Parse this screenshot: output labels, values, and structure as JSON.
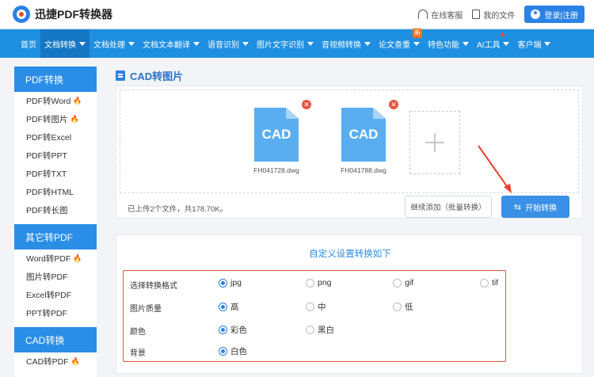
{
  "header": {
    "logo_text": "迅捷PDF转换器",
    "links": [
      {
        "icon": "headset-icon",
        "label": "在线客服"
      },
      {
        "icon": "file-icon",
        "label": "我的文件"
      }
    ],
    "login_label": "登录|注册"
  },
  "nav": {
    "items": [
      {
        "label": "首页"
      },
      {
        "label": "文档转换"
      },
      {
        "label": "文档处理"
      },
      {
        "label": "文档文本翻译"
      },
      {
        "label": "语音识别"
      },
      {
        "label": "图片文字识别"
      },
      {
        "label": "音视频转换"
      },
      {
        "label": "论文查重",
        "badge": "新"
      },
      {
        "label": "特色功能"
      },
      {
        "label": "AI工具"
      },
      {
        "label": "客户端"
      }
    ]
  },
  "sidebar": {
    "groups": [
      {
        "title": "PDF转换",
        "items": [
          "PDF转Word",
          "PDF转图片",
          "PDF转Excel",
          "PDF转PPT",
          "PDF转TXT",
          "PDF转HTML",
          "PDF转长图"
        ]
      },
      {
        "title": "其它转PDF",
        "items": [
          "Word转PDF",
          "图片转PDF",
          "Excel转PDF",
          "PPT转PDF"
        ]
      },
      {
        "title": "CAD转换",
        "items": [
          "CAD转PDF"
        ]
      }
    ]
  },
  "main": {
    "title": "CAD转图片",
    "files": [
      {
        "type_label": "CAD",
        "name": "FH041728.dwg"
      },
      {
        "type_label": "CAD",
        "name": "FH041788.dwg"
      }
    ],
    "remove_label": "✕",
    "upload_info": "已上传2个文件，共178.70K。",
    "continue_label": "继续添加（批量转换）",
    "start_label": "开始转换",
    "settings": {
      "title": "自定义设置转换如下",
      "rows": [
        {
          "label": "选择转换格式",
          "options": [
            "jpg",
            "png",
            "gif",
            "tif"
          ],
          "selected": "jpg"
        },
        {
          "label": "图片质量",
          "options": [
            "高",
            "中",
            "低"
          ],
          "selected": "高"
        },
        {
          "label": "颜色",
          "options": [
            "彩色",
            "黑白"
          ],
          "selected": "彩色"
        },
        {
          "label": "背景",
          "options": [
            "白色"
          ],
          "selected": "白色"
        }
      ]
    }
  },
  "colors": {
    "accent": "#1e8fe1",
    "highlight_box": "#e45440",
    "arrow": "#e8432f"
  }
}
